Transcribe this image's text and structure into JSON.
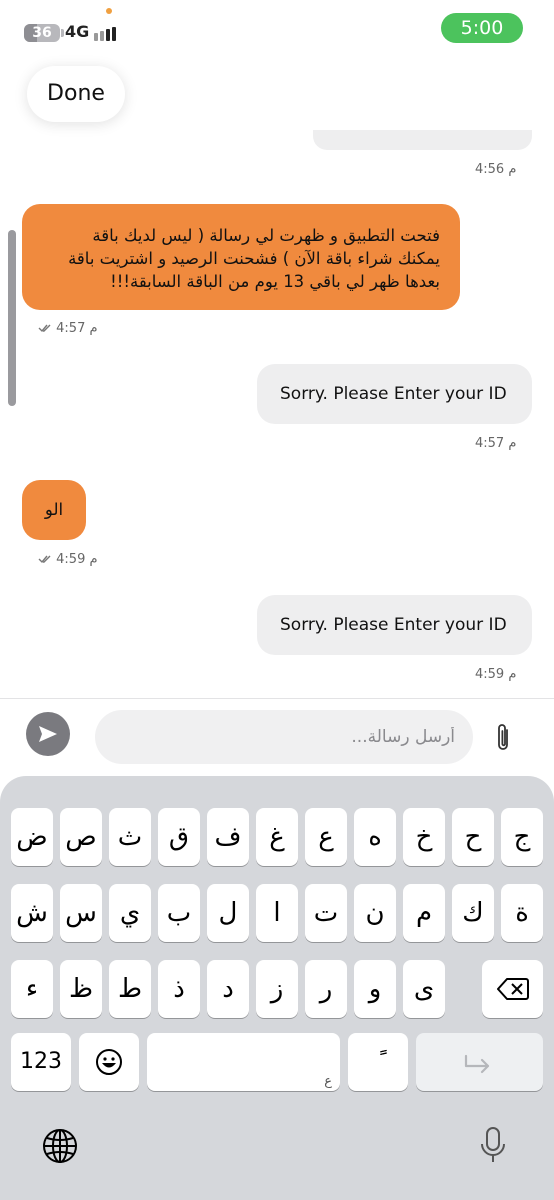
{
  "status_bar": {
    "battery": "36",
    "battery_fraction": 0.36,
    "network": "4G",
    "time": "5:00",
    "time_color": "#4cc35d"
  },
  "done_label": "Done",
  "messages": [
    {
      "from": "agent",
      "time": "4:56 م"
    },
    {
      "from": "user",
      "lines": [
        "فتحت التطبيق و ظهرت لي رسالة ( ليس لديك باقة",
        "يمكنك شراء باقة الآن ) فشحنت الرصيد و اشتريت باقة",
        "بعدها ظهر لي باقي 13 يوم من الباقة السابقة!!!"
      ],
      "time": "4:57 م",
      "read_icon": "double-check-icon"
    },
    {
      "from": "agent",
      "text": "Sorry. Please Enter your ID",
      "time": "4:57 م"
    },
    {
      "from": "user",
      "text": "الو",
      "time": "4:59 م",
      "read_icon": "double-check-icon"
    },
    {
      "from": "agent",
      "text": "Sorry. Please Enter your ID",
      "time": "4:59 م"
    }
  ],
  "composer": {
    "placeholder": "أرسل رسالة...",
    "send_icon": "send-icon",
    "attach_icon": "paperclip-icon"
  },
  "colors": {
    "user_bubble": "#f08a3e",
    "agent_bubble": "#eeeeef",
    "keyboard_bg": "#d5d7db"
  },
  "keyboard": {
    "row1": [
      "ض",
      "ص",
      "ث",
      "ق",
      "ف",
      "غ",
      "ع",
      "ه",
      "خ",
      "ح",
      "ج"
    ],
    "row2": [
      "ش",
      "س",
      "ي",
      "ب",
      "ل",
      "ا",
      "ت",
      "ن",
      "م",
      "ك",
      "ة"
    ],
    "row3": [
      "ء",
      "ظ",
      "ط",
      "ذ",
      "د",
      "ز",
      "ر",
      "و",
      "ى"
    ],
    "numbers_key": "123",
    "space_hint": "ع",
    "diacritic_key": "ًً",
    "icons": {
      "emoji": "emoji-icon",
      "backspace": "backspace-icon",
      "return": "return-icon",
      "globe": "globe-icon",
      "mic": "microphone-icon"
    }
  }
}
